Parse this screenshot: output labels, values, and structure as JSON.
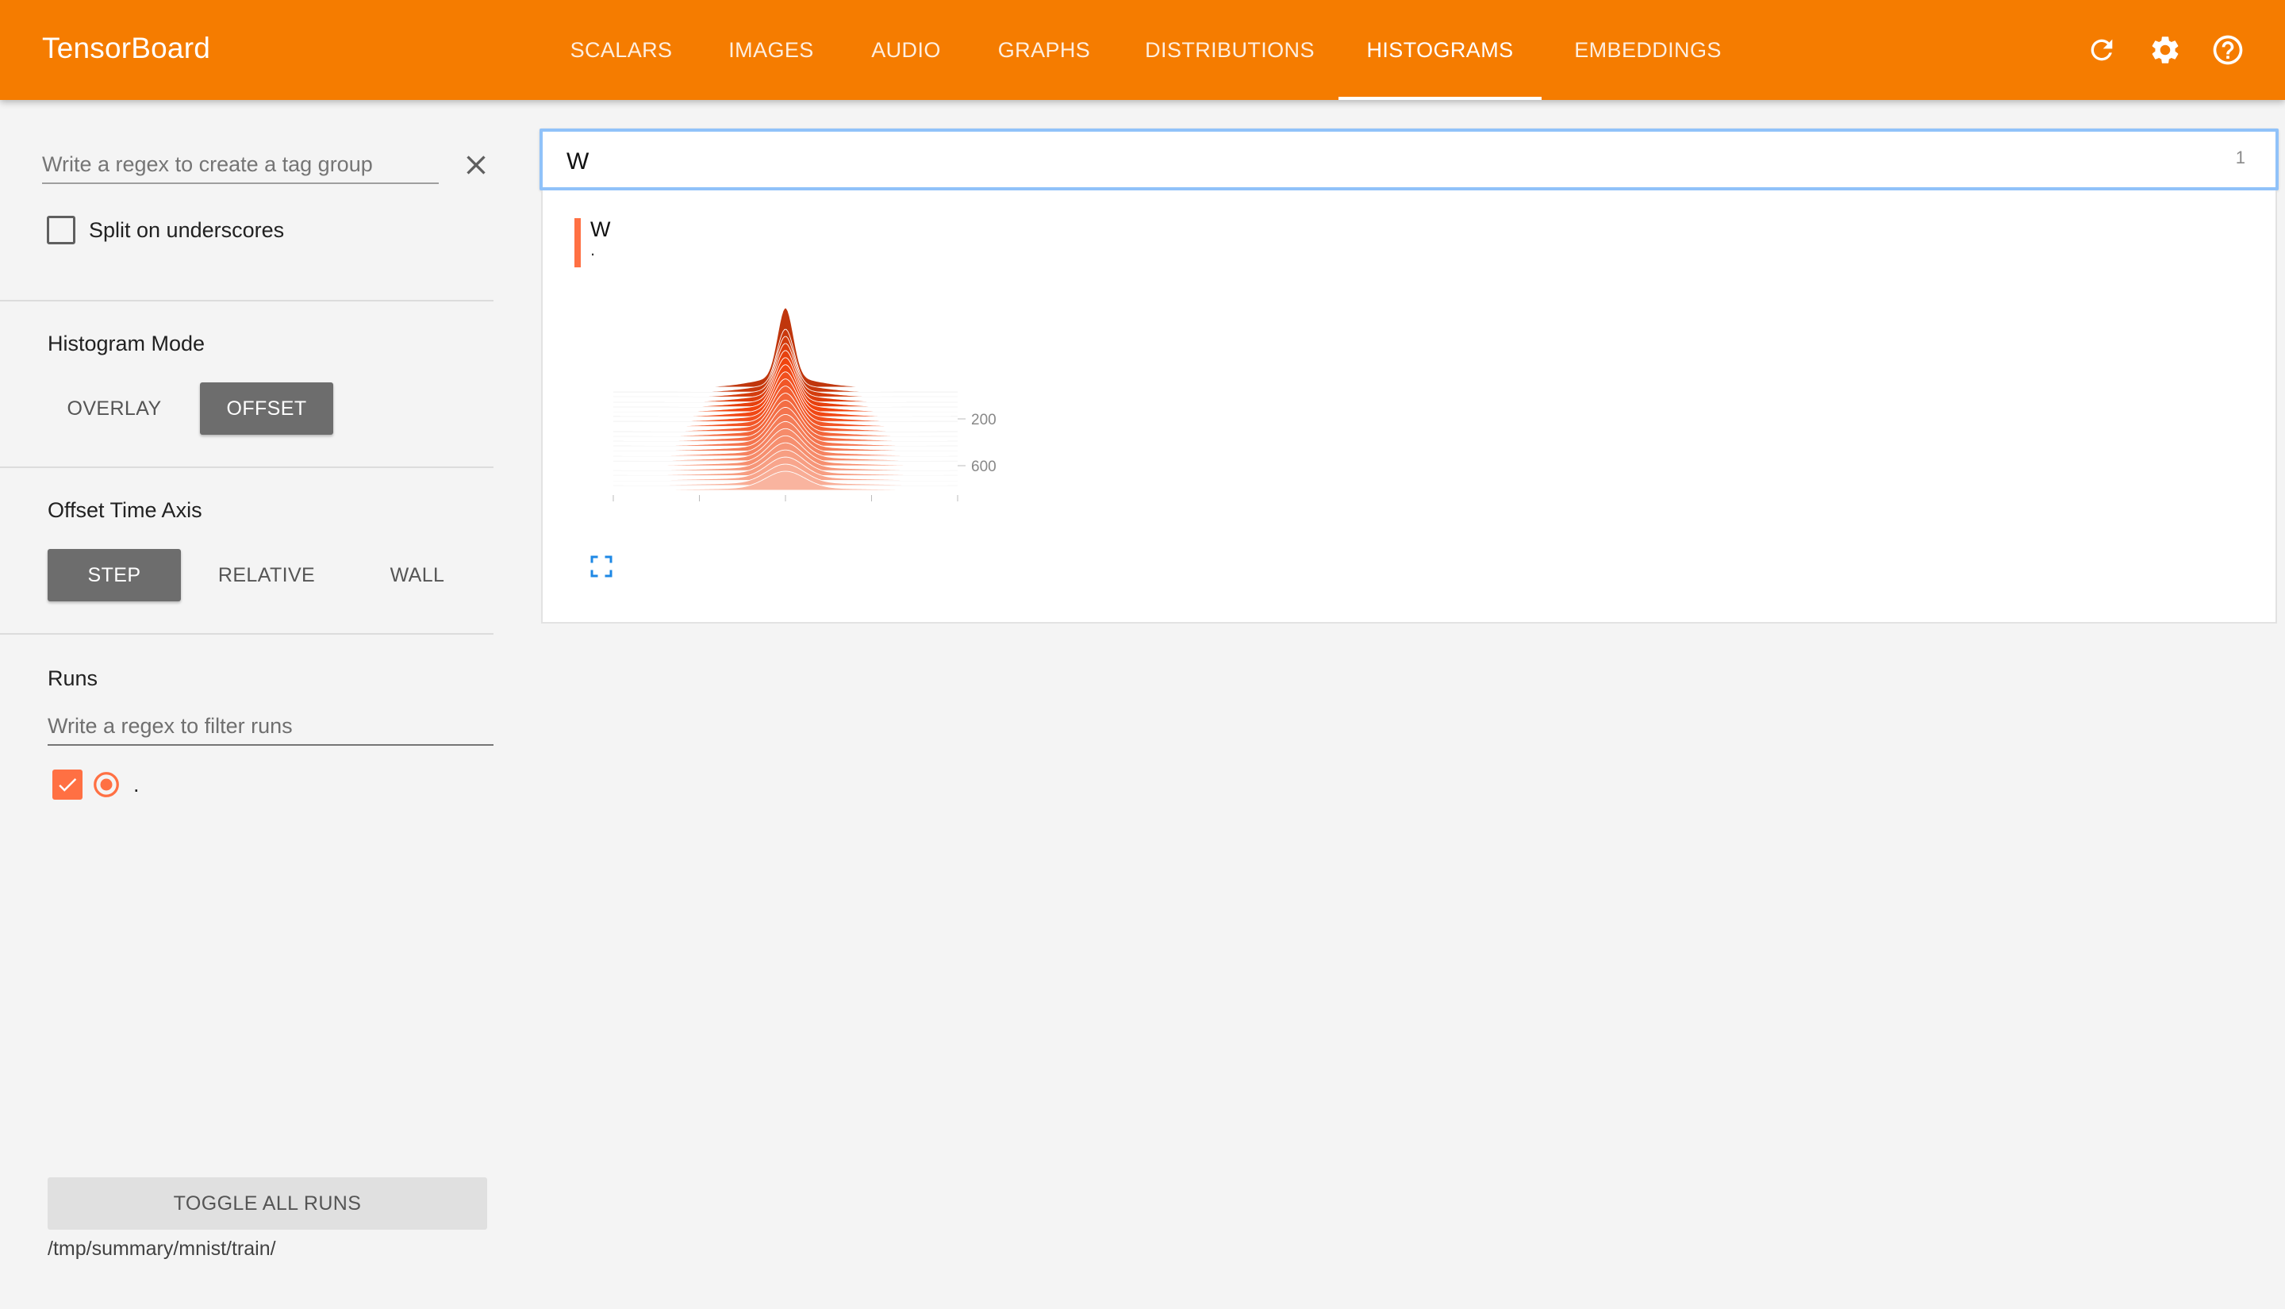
{
  "app": {
    "brand": "TensorBoard"
  },
  "header": {
    "tabs": [
      {
        "label": "SCALARS"
      },
      {
        "label": "IMAGES"
      },
      {
        "label": "AUDIO"
      },
      {
        "label": "GRAPHS"
      },
      {
        "label": "DISTRIBUTIONS"
      },
      {
        "label": "HISTOGRAMS",
        "active": true
      },
      {
        "label": "EMBEDDINGS"
      }
    ],
    "icons": [
      "refresh-icon",
      "settings-gear-icon",
      "help-circle-icon"
    ]
  },
  "sidebar": {
    "tag_group": {
      "placeholder": "Write a regex to create a tag group",
      "value": ""
    },
    "split_on_underscores": {
      "label": "Split on underscores",
      "checked": false
    },
    "histogram_mode": {
      "title": "Histogram Mode",
      "options": [
        "OVERLAY",
        "OFFSET"
      ],
      "selected": "OFFSET"
    },
    "offset_time_axis": {
      "title": "Offset Time Axis",
      "options": [
        "STEP",
        "RELATIVE",
        "WALL"
      ],
      "selected": "STEP"
    },
    "runs": {
      "title": "Runs",
      "filter_placeholder": "Write a regex to filter runs",
      "items": [
        {
          "name": ".",
          "checked": true,
          "color": "#ff7043"
        }
      ]
    },
    "toggle_all_label": "TOGGLE ALL RUNS",
    "data_path": "/tmp/summary/mnist/train/"
  },
  "main": {
    "filter": {
      "value": "W",
      "count": "1"
    },
    "card": {
      "title": "W",
      "run": "."
    }
  },
  "colors": {
    "header": "#f57c00",
    "accent": "#ff7043",
    "selected_toggle": "#6d6d6d",
    "focus_border": "#90c2f9"
  },
  "chart_data": {
    "type": "area",
    "mode": "offset",
    "x_ticks": [
      "-0.8",
      "-0.4",
      "0.0",
      "0.4",
      "0.8"
    ],
    "x_range": [
      -0.8,
      0.8
    ],
    "y_ticks": [
      "200",
      "600"
    ],
    "series_color": "#ff7043",
    "peak_x": 0.0
  }
}
